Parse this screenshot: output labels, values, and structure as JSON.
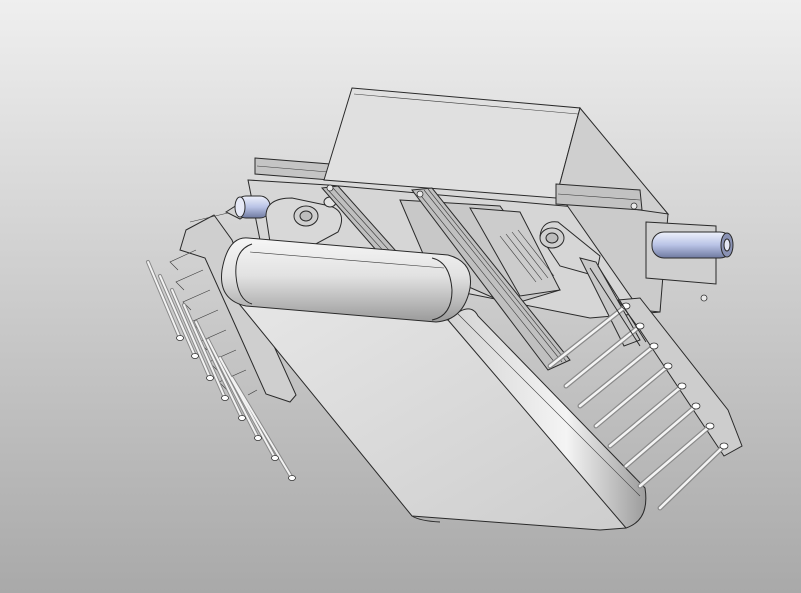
{
  "viewport": {
    "background_top": "#efefef",
    "background_bottom": "#a9a9a9",
    "view_mode": "shaded-with-edges",
    "projection": "isometric"
  },
  "model": {
    "part_colors": {
      "body": "#d9d9d9",
      "top_panel": "#e3e3e3",
      "rail": "#bdbdbd",
      "motor": "#b9c3e6",
      "rod": "#e6e6e6"
    },
    "icons": [
      "3d-model-icon"
    ]
  }
}
